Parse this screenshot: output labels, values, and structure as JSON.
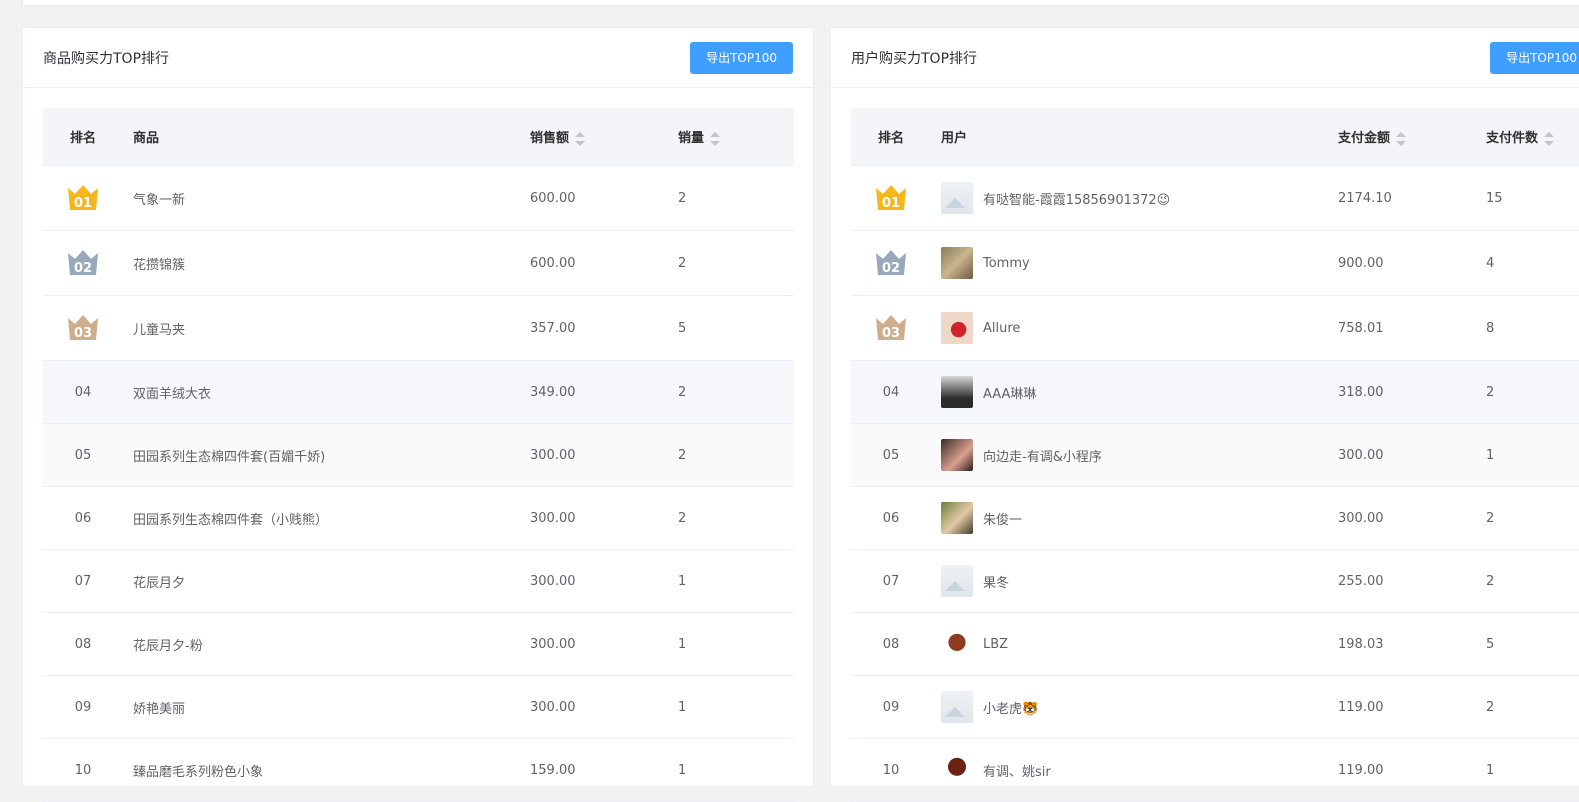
{
  "products": {
    "title": "商品购买力TOP排行",
    "export_label": "导出TOP100",
    "columns": {
      "rank": "排名",
      "name": "商品",
      "amount": "销售额",
      "qty": "销量"
    },
    "rows": [
      {
        "rank": "01",
        "name": "气象一新",
        "amount": "600.00",
        "qty": "2"
      },
      {
        "rank": "02",
        "name": "花攒锦簇",
        "amount": "600.00",
        "qty": "2"
      },
      {
        "rank": "03",
        "name": "儿童马夹",
        "amount": "357.00",
        "qty": "5"
      },
      {
        "rank": "04",
        "name": "双面羊绒大衣",
        "amount": "349.00",
        "qty": "2"
      },
      {
        "rank": "05",
        "name": "田园系列生态棉四件套(百媚千娇)",
        "amount": "300.00",
        "qty": "2"
      },
      {
        "rank": "06",
        "name": "田园系列生态棉四件套（小贱熊）",
        "amount": "300.00",
        "qty": "2"
      },
      {
        "rank": "07",
        "name": "花辰月夕",
        "amount": "300.00",
        "qty": "1"
      },
      {
        "rank": "08",
        "name": "花辰月夕-粉",
        "amount": "300.00",
        "qty": "1"
      },
      {
        "rank": "09",
        "name": "娇艳美丽",
        "amount": "300.00",
        "qty": "1"
      },
      {
        "rank": "10",
        "name": "臻品磨毛系列粉色小象",
        "amount": "159.00",
        "qty": "1"
      }
    ]
  },
  "users": {
    "title": "用户购买力TOP排行",
    "export_label": "导出TOP100",
    "columns": {
      "rank": "排名",
      "name": "用户",
      "amount": "支付金额",
      "qty": "支付件数"
    },
    "rows": [
      {
        "rank": "01",
        "name": "有哒智能-霞霞15856901372😉",
        "amount": "2174.10",
        "qty": "15",
        "avatar": "placeholder"
      },
      {
        "rank": "02",
        "name": "Tommy",
        "amount": "900.00",
        "qty": "4",
        "avatar": "photo-1"
      },
      {
        "rank": "03",
        "name": "Allure",
        "amount": "758.01",
        "qty": "8",
        "avatar": "photo-2"
      },
      {
        "rank": "04",
        "name": "AAA琳琳",
        "amount": "318.00",
        "qty": "2",
        "avatar": "photo-3"
      },
      {
        "rank": "05",
        "name": "向边走-有调&小程序",
        "amount": "300.00",
        "qty": "1",
        "avatar": "photo-4"
      },
      {
        "rank": "06",
        "name": "朱俊一",
        "amount": "300.00",
        "qty": "2",
        "avatar": "photo-5"
      },
      {
        "rank": "07",
        "name": "果冬",
        "amount": "255.00",
        "qty": "2",
        "avatar": "placeholder"
      },
      {
        "rank": "08",
        "name": "LBZ",
        "amount": "198.03",
        "qty": "5",
        "avatar": "cartoon-1"
      },
      {
        "rank": "09",
        "name": "小老虎🐯",
        "amount": "119.00",
        "qty": "2",
        "avatar": "placeholder"
      },
      {
        "rank": "10",
        "name": "有调、姚sir",
        "amount": "119.00",
        "qty": "1",
        "avatar": "cartoon-2"
      }
    ]
  },
  "colors": {
    "primary": "#409eff",
    "gold": "#f5b71c",
    "silver": "#9aa8bc",
    "bronze": "#cfae8e"
  }
}
